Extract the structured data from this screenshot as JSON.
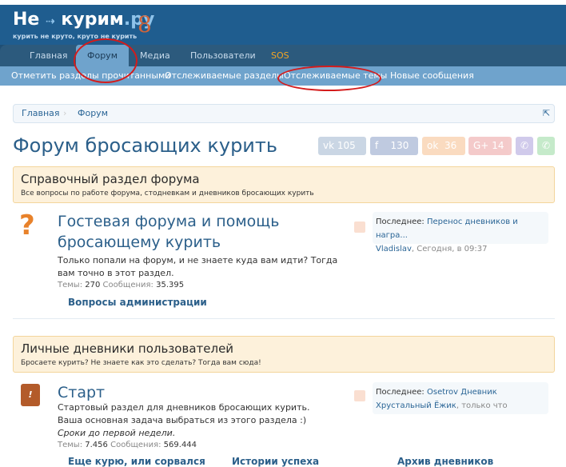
{
  "logo": {
    "title_a": "Не",
    "title_b": "курим",
    "title_c": ".ру",
    "tagline": "курить не круто, круто не курить"
  },
  "nav": {
    "tabs": [
      "Главная",
      "Форум",
      "Медиа",
      "Пользователи",
      "SOS"
    ]
  },
  "subnav": [
    "Отметить разделы прочитанными",
    "Отслеживаемые разделы",
    "Отслеживаемые темы",
    "Новые сообщения"
  ],
  "breadcrumb": [
    "Главная",
    "Форум"
  ],
  "page_title": "Форум бросающих курить",
  "share": [
    {
      "icon": "vk",
      "count": "105"
    },
    {
      "icon": "f",
      "count": "130"
    },
    {
      "icon": "ok",
      "count": "36"
    },
    {
      "icon": "G+",
      "count": "14"
    }
  ],
  "categories": [
    {
      "title": "Справочный раздел форума",
      "desc": "Все вопросы по работе форума, стодневкам и дневников бросающих курить"
    },
    {
      "title": "Личные дневники пользователей",
      "desc": "Бросаете курить? Не знаете как это сделать? Тогда вам сюда!"
    }
  ],
  "forums": [
    {
      "name_l1": "Гостевая форума и помощь",
      "name_l2": "бросающему курить",
      "desc": "Только попали на форум, и не знаете куда вам идти? Тогда вам точно в этот раздел.",
      "topics_label": "Темы:",
      "topics": "270",
      "posts_label": "Сообщения:",
      "posts": "35.395",
      "last_label": "Последнее:",
      "last_title": "Перенос дневников и награ...",
      "last_user": "Vladislav",
      "last_time": ", Сегодня, в 09:37",
      "sub": [
        "Вопросы администрации"
      ]
    },
    {
      "name": "Старт",
      "desc": "Стартовый раздел для дневников бросающих курить. Ваша основная задача выбраться из этого раздела :)",
      "desc_italic": "Сроки до первой недели.",
      "topics_label": "Темы:",
      "topics": "7.456",
      "posts_label": "Сообщения:",
      "posts": "569.444",
      "last_label": "Последнее:",
      "last_title": "Osetrov Дневник",
      "last_user": "Хрустальный Ёжик",
      "last_time": ", только что",
      "sub": [
        "Еще курю, или сорвался",
        "Истории успеха",
        "Архив дневников"
      ]
    }
  ]
}
